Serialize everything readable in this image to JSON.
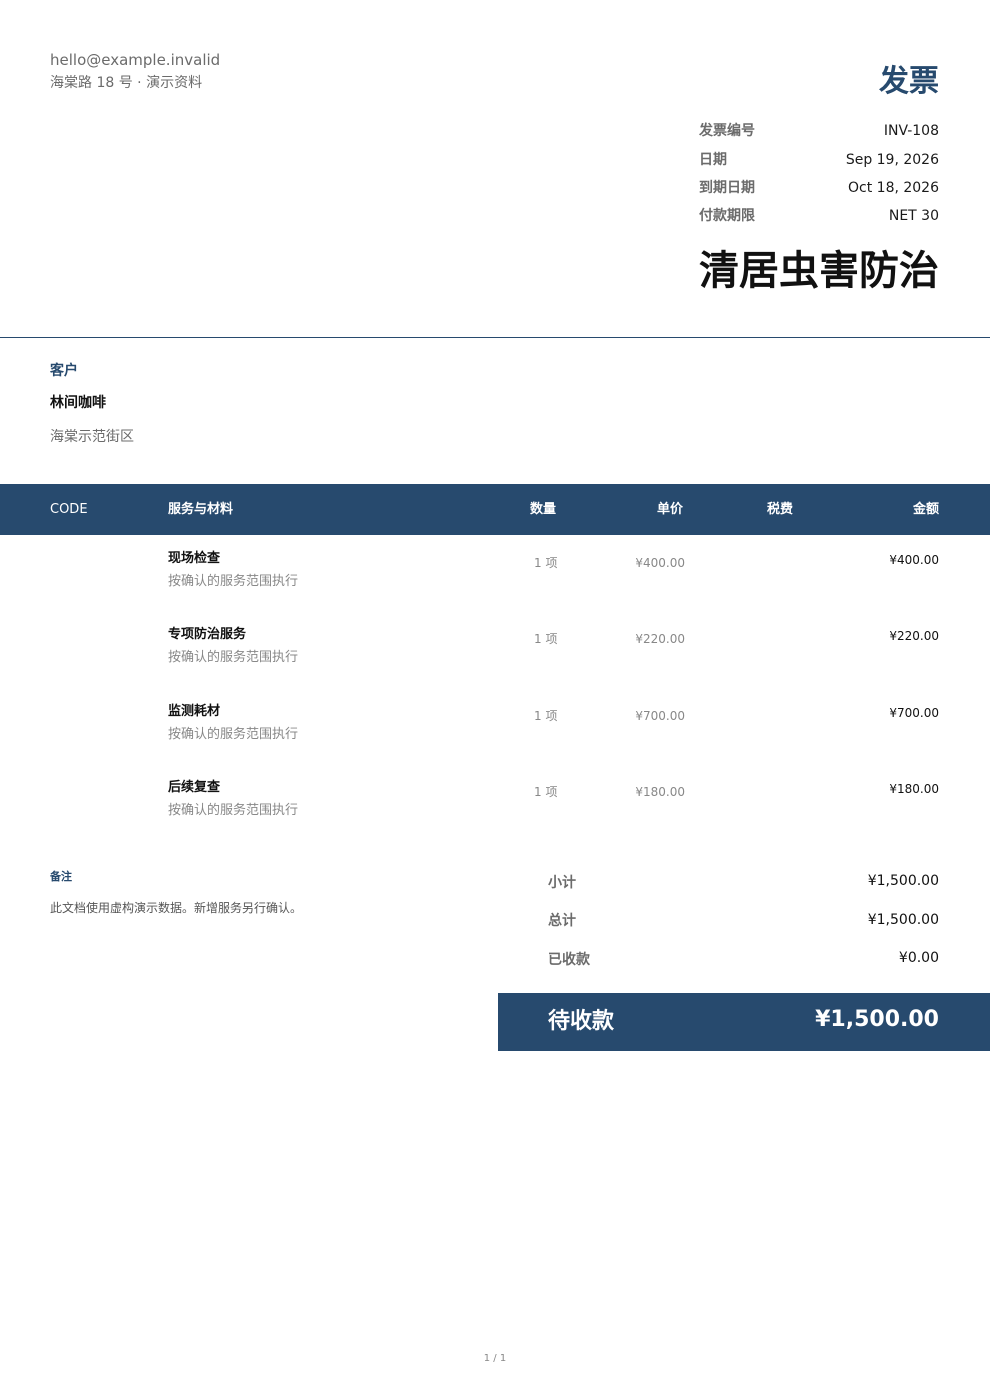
{
  "sender": {
    "email": "hello@example.invalid",
    "address": "海棠路 18 号 · 演示资料"
  },
  "document": {
    "title": "发票",
    "meta": [
      {
        "label": "发票编号",
        "value": "INV-108"
      },
      {
        "label": "日期",
        "value": "Sep 19, 2026"
      },
      {
        "label": "到期日期",
        "value": "Oct 18, 2026"
      },
      {
        "label": "付款期限",
        "value": "NET 30"
      }
    ],
    "company_name": "清居虫害防治"
  },
  "client": {
    "label": "客户",
    "name": "林间咖啡",
    "address": "海棠示范街区"
  },
  "table": {
    "headers": {
      "code": "CODE",
      "description": "服务与材料",
      "quantity": "数量",
      "unit_price": "单价",
      "tax": "税费",
      "amount": "金额"
    },
    "rows": [
      {
        "code": "",
        "name": "现场检查",
        "description": "按确认的服务范围执行",
        "quantity": "1 项",
        "unit_price": "¥400.00",
        "tax": "",
        "amount": "¥400.00"
      },
      {
        "code": "",
        "name": "专项防治服务",
        "description": "按确认的服务范围执行",
        "quantity": "1 项",
        "unit_price": "¥220.00",
        "tax": "",
        "amount": "¥220.00"
      },
      {
        "code": "",
        "name": "监测耗材",
        "description": "按确认的服务范围执行",
        "quantity": "1 项",
        "unit_price": "¥700.00",
        "tax": "",
        "amount": "¥700.00"
      },
      {
        "code": "",
        "name": "后续复查",
        "description": "按确认的服务范围执行",
        "quantity": "1 项",
        "unit_price": "¥180.00",
        "tax": "",
        "amount": "¥180.00"
      }
    ]
  },
  "notes": {
    "label": "备注",
    "text": "此文档使用虚构演示数据。新增服务另行确认。"
  },
  "summary": {
    "subtotal_label": "小计",
    "subtotal_value": "¥1,500.00",
    "total_label": "总计",
    "total_value": "¥1,500.00",
    "paid_label": "已收款",
    "paid_value": "¥0.00",
    "balance_label": "待收款",
    "balance_value": "¥1,500.00"
  },
  "footer": {
    "page": "1 / 1"
  },
  "colors": {
    "accent": "#274a6e",
    "muted": "#6b6b6b"
  }
}
